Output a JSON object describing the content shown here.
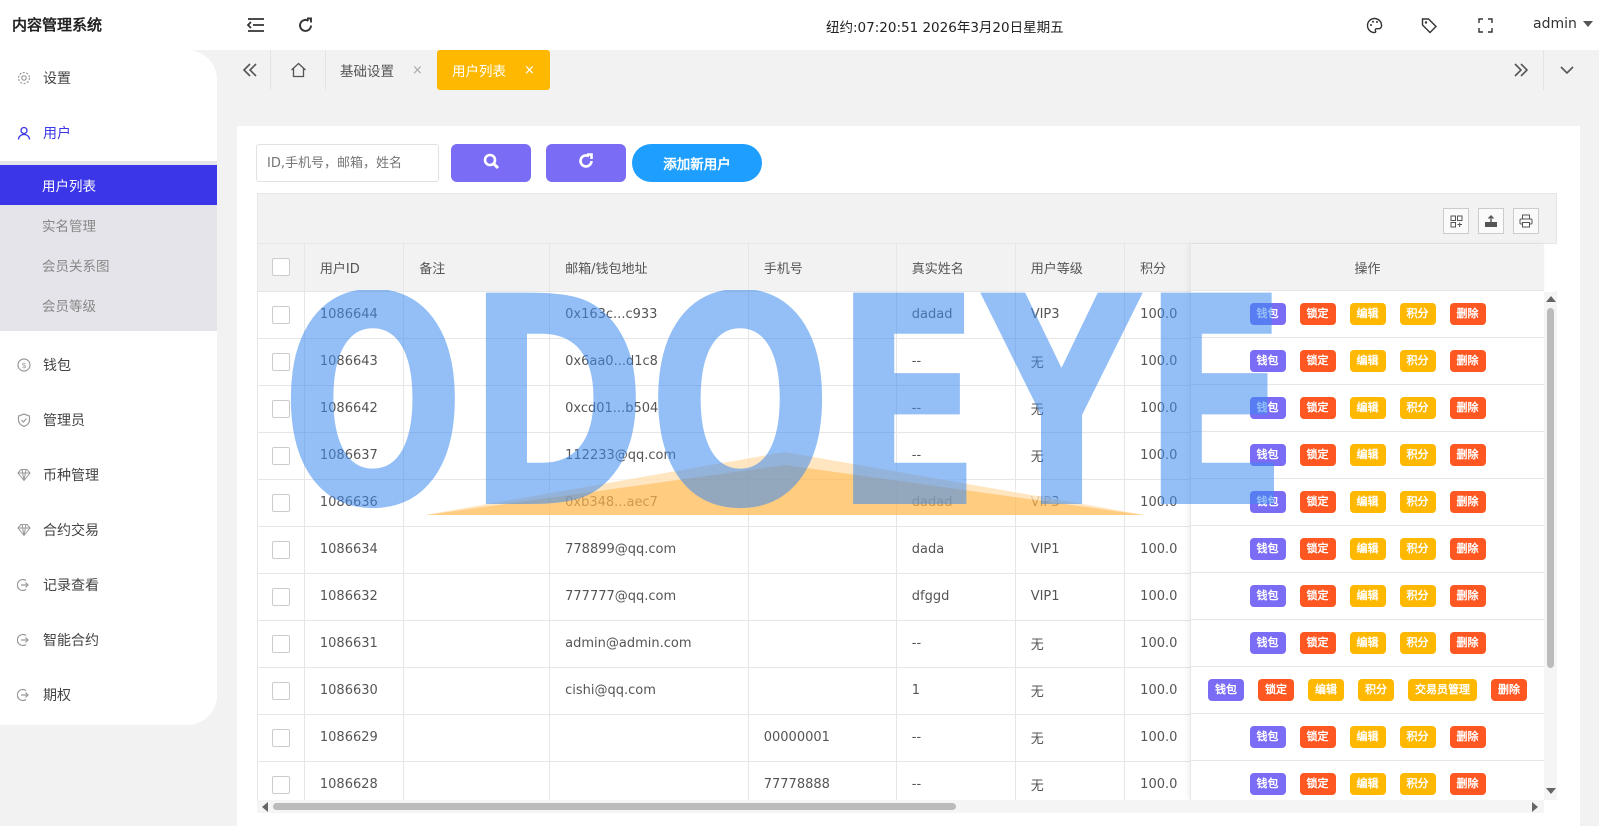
{
  "app": {
    "title": "内容管理系统"
  },
  "header": {
    "clock": "纽约:07:20:51 2026年3月20日星期五",
    "user": "admin",
    "icons": [
      "menu-collapse-icon",
      "refresh-icon",
      "palette-icon",
      "tag-icon",
      "fullscreen-icon"
    ]
  },
  "sidebar": {
    "items": [
      {
        "label": "设置",
        "icon": "gear-icon"
      },
      {
        "label": "用户",
        "icon": "user-icon"
      },
      {
        "label": "钱包",
        "icon": "dollar-icon"
      },
      {
        "label": "管理员",
        "icon": "shield-icon"
      },
      {
        "label": "币种管理",
        "icon": "diamond-icon"
      },
      {
        "label": "合约交易",
        "icon": "diamond-icon"
      },
      {
        "label": "记录查看",
        "icon": "login-icon"
      },
      {
        "label": "智能合约",
        "icon": "login-icon"
      },
      {
        "label": "期权",
        "icon": "login-icon"
      }
    ],
    "submenu": [
      "用户列表",
      "实名管理",
      "会员关系图",
      "会员等级"
    ]
  },
  "tabs": [
    {
      "label": "基础设置",
      "close": "×"
    },
    {
      "label": "用户列表",
      "close": "×"
    }
  ],
  "toolbar": {
    "search_placeholder": "ID,手机号，邮箱，姓名",
    "add_user": "添加新用户"
  },
  "table": {
    "columns": [
      "用户ID",
      "备注",
      "邮箱/钱包地址",
      "手机号",
      "真实姓名",
      "用户等级",
      "积分"
    ],
    "ops_header": "操作",
    "rows": [
      {
        "id": "1086644",
        "note": "",
        "email": "0x163c...c933",
        "phone": "",
        "name": "dadad",
        "level": "VIP3",
        "points": "100.0"
      },
      {
        "id": "1086643",
        "note": "",
        "email": "0x6aa0...d1c8",
        "phone": "",
        "name": "--",
        "level": "无",
        "points": "100.0"
      },
      {
        "id": "1086642",
        "note": "",
        "email": "0xcd01...b504",
        "phone": "",
        "name": "--",
        "level": "无",
        "points": "100.0"
      },
      {
        "id": "1086637",
        "note": "",
        "email": "112233@qq.com",
        "phone": "",
        "name": "--",
        "level": "无",
        "points": "100.0"
      },
      {
        "id": "1086636",
        "note": "",
        "email": "0xb348...aec7",
        "phone": "",
        "name": "dadad",
        "level": "VIP3",
        "points": "100.0"
      },
      {
        "id": "1086634",
        "note": "",
        "email": "778899@qq.com",
        "phone": "",
        "name": "dada",
        "level": "VIP1",
        "points": "100.0"
      },
      {
        "id": "1086632",
        "note": "",
        "email": "777777@qq.com",
        "phone": "",
        "name": "dfggd",
        "level": "VIP1",
        "points": "100.0"
      },
      {
        "id": "1086631",
        "note": "",
        "email": "admin@admin.com",
        "phone": "",
        "name": "--",
        "level": "无",
        "points": "100.0"
      },
      {
        "id": "1086630",
        "note": "",
        "email": "cishi@qq.com",
        "phone": "",
        "name": "1",
        "level": "无",
        "points": "100.0"
      },
      {
        "id": "1086629",
        "note": "",
        "email": "",
        "phone": "00000001",
        "name": "--",
        "level": "无",
        "points": "100.0"
      },
      {
        "id": "1086628",
        "note": "",
        "email": "",
        "phone": "77778888",
        "name": "--",
        "level": "无",
        "points": "100.0"
      }
    ],
    "actions": {
      "wallet": "钱包",
      "lock": "锁定",
      "edit": "编辑",
      "points": "积分",
      "trader": "交易员管理",
      "delete": "删除"
    }
  },
  "watermark": {
    "text": "ODOEYE"
  },
  "colors": {
    "accent": "#3b36e8",
    "tab_active": "#ffb800",
    "btn_purple": "#7b6cf6",
    "btn_blue": "#1e9fff",
    "danger": "#ff5722"
  }
}
